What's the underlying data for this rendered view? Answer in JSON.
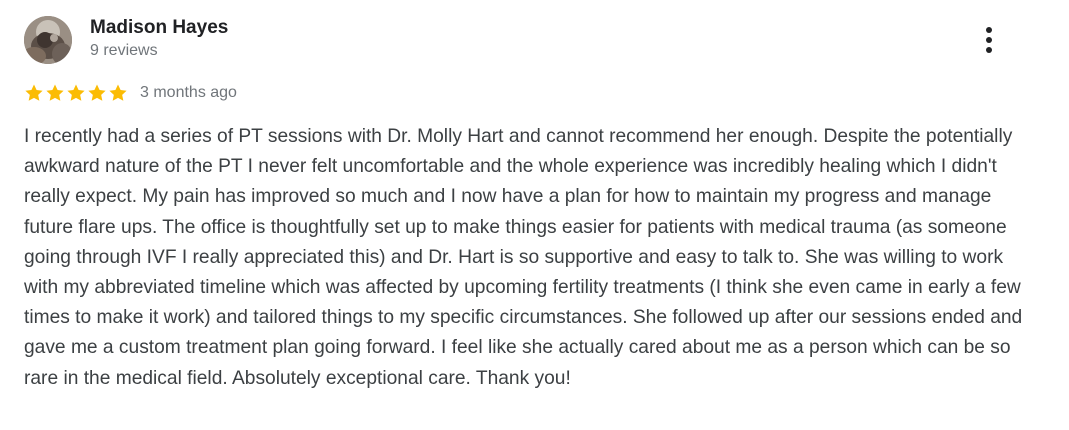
{
  "review": {
    "reviewer_name": "Madison Hayes",
    "review_count": "9 reviews",
    "rating": 5,
    "rating_max": 5,
    "date": "3 months ago",
    "text": "I recently had a series of PT sessions with Dr. Molly Hart and cannot recommend her enough. Despite the potentially awkward nature of the PT I never felt uncomfortable and the whole experience was incredibly healing which I didn't really expect. My pain has improved so much and I now have a plan for how to maintain my progress and manage future flare ups. The office is thoughtfully set up to make things easier for patients with medical trauma (as someone going through IVF I really appreciated this) and Dr. Hart is so supportive and easy to talk to. She was willing to work with my abbreviated timeline which was affected by upcoming fertility treatments (I think she even came in early a few times to make it work) and tailored things to my specific circumstances. She followed up after our sessions ended and gave me a custom treatment plan going forward. I feel like she actually cared about me as a person which can be so rare in the medical field. Absolutely exceptional care. Thank you!"
  },
  "icons": {
    "more": "more-vert-icon",
    "star": "star-icon",
    "avatar": "profile-photo"
  },
  "colors": {
    "star": "#fbbc04",
    "name": "#202124",
    "secondary": "#70757a",
    "body": "#3c4043",
    "more_dots": "#5f6368"
  }
}
